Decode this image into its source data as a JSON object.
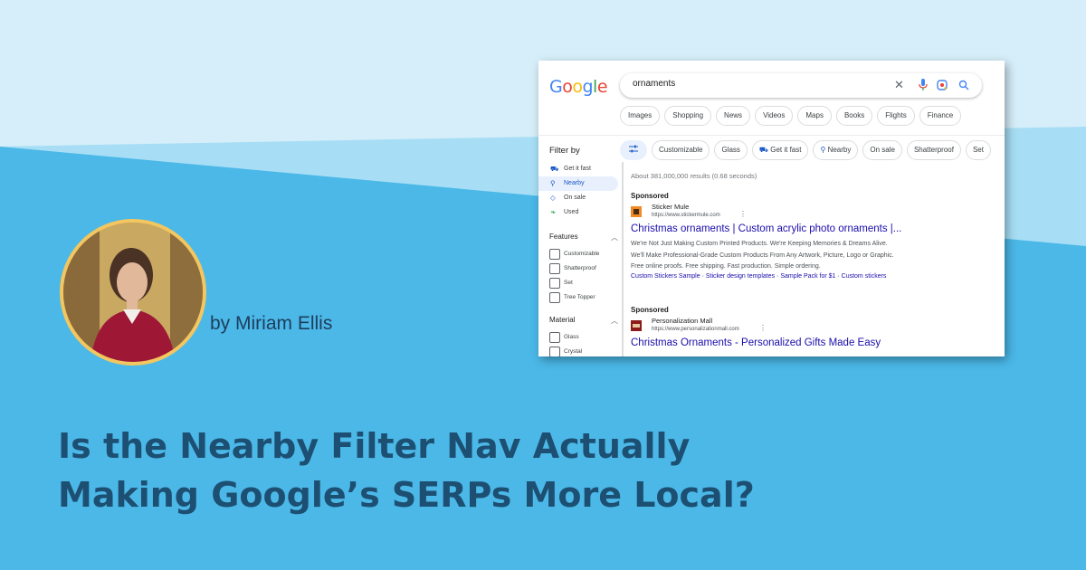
{
  "colors": {
    "background": "#4bb8e8",
    "band_light": "#a7def5",
    "band_lightest": "#d6eef9",
    "headline": "#1d4f72",
    "photo_ring": "#f3c65f",
    "link_blue": "#1a0dab",
    "active_blue": "#1a56c5"
  },
  "byline": "by Miriam Ellis",
  "headline": {
    "line1": "Is the Nearby Filter Nav Actually",
    "line2": "Making Google’s SERPs More Local?"
  },
  "serp": {
    "logo_letters": [
      {
        "ch": "G",
        "color": "#4285f4"
      },
      {
        "ch": "o",
        "color": "#ea4335"
      },
      {
        "ch": "o",
        "color": "#fbbc05"
      },
      {
        "ch": "g",
        "color": "#4285f4"
      },
      {
        "ch": "l",
        "color": "#34a853"
      },
      {
        "ch": "e",
        "color": "#ea4335"
      }
    ],
    "search_query": "ornaments",
    "search_icons": [
      "close-icon",
      "microphone-icon",
      "lens-icon",
      "search-icon"
    ],
    "tabs": [
      "Images",
      "Shopping",
      "News",
      "Videos",
      "Maps",
      "Books",
      "Flights",
      "Finance"
    ],
    "filter_by": "Filter by",
    "chips": [
      "Customizable",
      "Glass",
      "Get it fast",
      "Nearby",
      "On sale",
      "Shatterproof",
      "Set"
    ],
    "sidebar_items": [
      {
        "label": "Get it fast",
        "icon": "truck-icon",
        "active": false
      },
      {
        "label": "Nearby",
        "icon": "location-pin-icon",
        "active": true
      },
      {
        "label": "On sale",
        "icon": "tag-icon",
        "active": false
      },
      {
        "label": "Used",
        "icon": "leaf-icon",
        "active": false
      }
    ],
    "features_title": "Features",
    "features": [
      "Customizable",
      "Shatterproof",
      "Set",
      "Tree Topper"
    ],
    "material_title": "Material",
    "materials": [
      "Glass",
      "Crystal"
    ],
    "results_count": "About 381,000,000 results (0.68 seconds)",
    "ads": [
      {
        "sponsored": "Sponsored",
        "advertiser": "Sticker Mule",
        "url": "https://www.stickermule.com",
        "title": "Christmas ornaments | Custom acrylic photo ornaments |...",
        "desc1": "We're Not Just Making Custom Printed Products. We're Keeping Memories & Dreams Alive.",
        "desc2": "We'll Make Professional-Grade Custom Products From Any Artwork, Picture, Logo or Graphic.",
        "desc3": "Free online proofs. Free shipping. Fast production. Simple ordering.",
        "links": "Custom Stickers Sample · Sticker design templates · Sample Pack for $1 · Custom stickers"
      },
      {
        "sponsored": "Sponsored",
        "advertiser": "Personalization Mall",
        "url": "https://www.personalizationmall.com",
        "title": "Christmas Ornaments - Personalized Gifts Made Easy"
      }
    ]
  }
}
